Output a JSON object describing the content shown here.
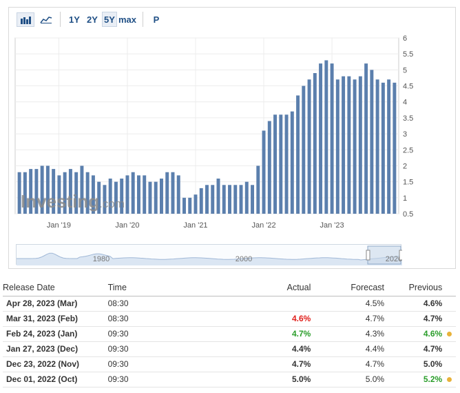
{
  "toolbar": {
    "bar_chart_icon": "bar-chart-icon",
    "line_chart_icon": "line-chart-icon",
    "periods": [
      "1Y",
      "2Y",
      "5Y",
      "max"
    ],
    "active_period": "5Y",
    "p_label": "P"
  },
  "chart_data": {
    "type": "bar",
    "bar_color": "#5b7fad",
    "x_tick_labels": [
      "Jan '19",
      "Jan '20",
      "Jan '21",
      "Jan '22",
      "Jan '23"
    ],
    "y_ticks": [
      "6",
      "5.5",
      "5",
      "4.5",
      "4",
      "3.5",
      "3",
      "2.5",
      "2",
      "1.5",
      "1",
      "0.5"
    ],
    "ylim": [
      0.5,
      6
    ],
    "grid": true,
    "values": [
      1.8,
      1.8,
      1.9,
      1.9,
      2.0,
      2.0,
      1.9,
      1.7,
      1.8,
      1.9,
      1.8,
      2.0,
      1.8,
      1.7,
      1.5,
      1.4,
      1.6,
      1.5,
      1.6,
      1.7,
      1.8,
      1.7,
      1.7,
      1.5,
      1.5,
      1.6,
      1.8,
      1.8,
      1.7,
      1.0,
      1.0,
      1.1,
      1.3,
      1.4,
      1.4,
      1.6,
      1.4,
      1.4,
      1.4,
      1.4,
      1.5,
      1.4,
      2.0,
      3.1,
      3.4,
      3.6,
      3.6,
      3.6,
      3.7,
      4.2,
      4.5,
      4.7,
      4.9,
      5.2,
      5.3,
      5.2,
      4.7,
      4.8,
      4.8,
      4.7,
      4.8,
      5.2,
      5.0,
      4.7,
      4.6,
      4.7,
      4.6
    ],
    "watermark": "Investing",
    "watermark_suffix": ".com",
    "navigator_labels": [
      "1980",
      "2000",
      "2020"
    ]
  },
  "table": {
    "headers": [
      "Release Date",
      "Time",
      "Actual",
      "Forecast",
      "Previous"
    ],
    "rows": [
      {
        "date": "Apr 28, 2023 (Mar)",
        "time": "08:30",
        "actual": "",
        "actual_color": "#333333",
        "forecast": "4.5%",
        "previous": "4.6%",
        "previous_color": "#333333",
        "dot": ""
      },
      {
        "date": "Mar 31, 2023 (Feb)",
        "time": "08:30",
        "actual": "4.6%",
        "actual_color": "#e0201c",
        "forecast": "4.7%",
        "previous": "4.7%",
        "previous_color": "#333333",
        "dot": ""
      },
      {
        "date": "Feb 24, 2023 (Jan)",
        "time": "09:30",
        "actual": "4.7%",
        "actual_color": "#2a9d2a",
        "forecast": "4.3%",
        "previous": "4.6%",
        "previous_color": "#2a9d2a",
        "dot": "#e8b23a"
      },
      {
        "date": "Jan 27, 2023 (Dec)",
        "time": "09:30",
        "actual": "4.4%",
        "actual_color": "#333333",
        "forecast": "4.4%",
        "previous": "4.7%",
        "previous_color": "#333333",
        "dot": ""
      },
      {
        "date": "Dec 23, 2022 (Nov)",
        "time": "09:30",
        "actual": "4.7%",
        "actual_color": "#333333",
        "forecast": "4.7%",
        "previous": "5.0%",
        "previous_color": "#333333",
        "dot": ""
      },
      {
        "date": "Dec 01, 2022 (Oct)",
        "time": "09:30",
        "actual": "5.0%",
        "actual_color": "#333333",
        "forecast": "5.0%",
        "previous": "5.2%",
        "previous_color": "#2a9d2a",
        "dot": "#e8b23a"
      }
    ]
  }
}
